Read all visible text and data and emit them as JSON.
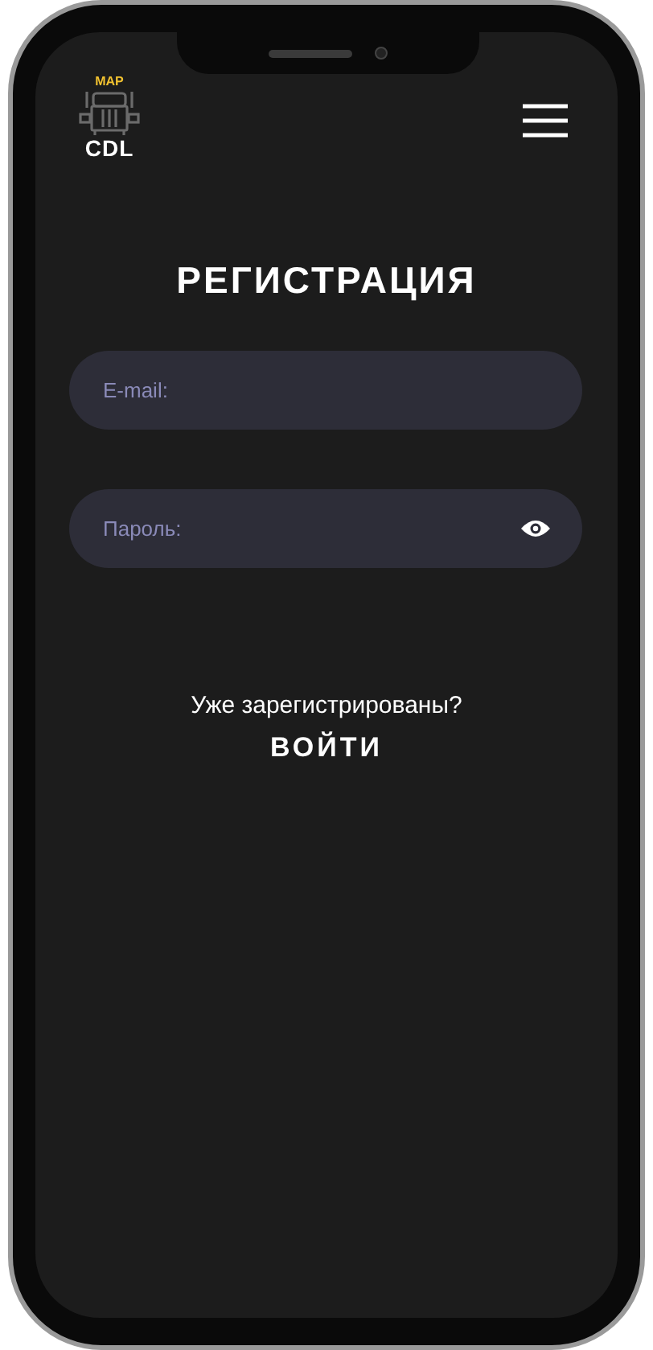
{
  "logo": {
    "top_text": "MAP",
    "bottom_text": "CDL"
  },
  "title": "РЕГИСТРАЦИЯ",
  "fields": [
    {
      "placeholder": "E-mail:",
      "kind": "text"
    },
    {
      "placeholder": "Пароль:",
      "kind": "password"
    }
  ],
  "login_prompt": "Уже зарегистрированы?",
  "login_link": "ВОЙТИ"
}
